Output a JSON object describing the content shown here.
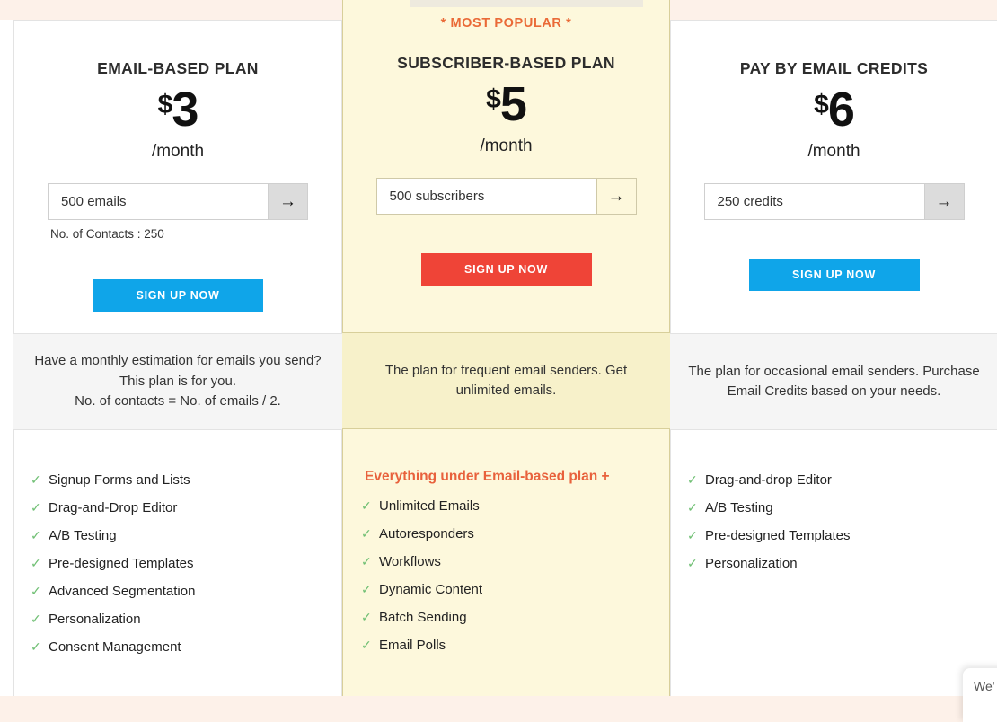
{
  "theme": {
    "page_background": "#fdf1e9",
    "card_background": "#ffffff",
    "featured_background": "#fdf8dc",
    "featured_description_background": "#f7f1ca",
    "description_background": "#f5f5f5",
    "cta_blue": "#0fa5e9",
    "cta_red": "#ef4437",
    "accent_orange": "#ea6a37",
    "tick_green": "#6fbf73"
  },
  "plans": [
    {
      "id": "email-based-plan",
      "badge": null,
      "title": "EMAIL-BASED PLAN",
      "currency": "$",
      "price": "3",
      "period": "/month",
      "quantity_value": "500 emails",
      "quantity_placeholder": "500 emails",
      "arrow_label": "→",
      "note": "No. of Contacts : 250",
      "cta_label": "SIGN UP NOW",
      "cta_color": "#0fa5e9",
      "description": "Have a monthly estimation for emails you send?\nThis plan is for you.\nNo. of contacts = No. of emails / 2.",
      "features_heading": null,
      "features": [
        "Signup Forms and Lists",
        "Drag-and-Drop Editor",
        "A/B Testing",
        "Pre-designed Templates",
        "Advanced Segmentation",
        "Personalization",
        "Consent Management"
      ]
    },
    {
      "id": "subscriber-based-plan",
      "badge": "* MOST POPULAR *",
      "title": "SUBSCRIBER-BASED PLAN",
      "currency": "$",
      "price": "5",
      "period": "/month",
      "quantity_value": "500 subscribers",
      "quantity_placeholder": "500 subscribers",
      "arrow_label": "→",
      "note": null,
      "cta_label": "SIGN UP NOW",
      "cta_color": "#ef4437",
      "description": "The plan for frequent email senders. Get unlimited emails.",
      "features_heading": "Everything under Email-based plan +",
      "features": [
        "Unlimited Emails",
        "Autoresponders",
        "Workflows",
        "Dynamic Content",
        "Batch Sending",
        "Email Polls"
      ]
    },
    {
      "id": "pay-by-email-credits",
      "badge": null,
      "title": "PAY BY EMAIL CREDITS",
      "currency": "$",
      "price": "6",
      "period": "/month",
      "quantity_value": "250 credits",
      "quantity_placeholder": "250 credits",
      "arrow_label": "→",
      "note": null,
      "cta_label": "SIGN UP NOW",
      "cta_color": "#0fa5e9",
      "description": "The plan for occasional email senders. Purchase Email Credits based on your needs.",
      "features_heading": null,
      "features": [
        "Drag-and-drop Editor",
        "A/B Testing",
        "Pre-designed Templates",
        "Personalization"
      ]
    }
  ],
  "tick_glyph": "✓",
  "chat_widget": {
    "text": "We'"
  }
}
